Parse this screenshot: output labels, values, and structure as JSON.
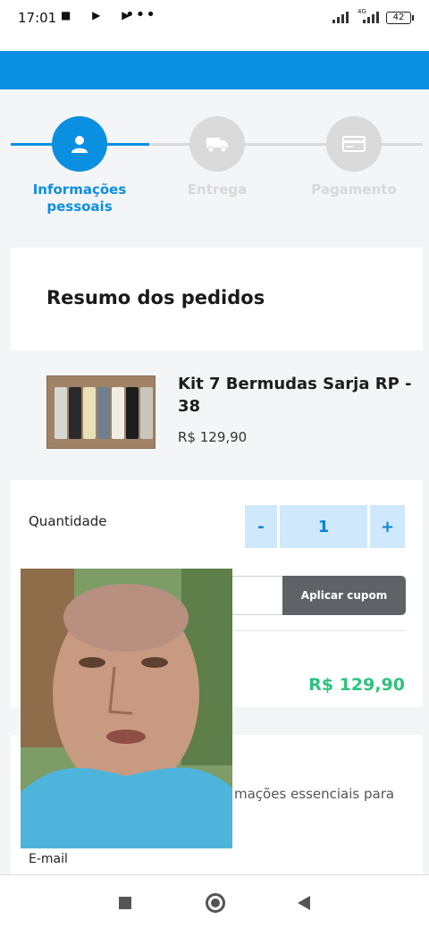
{
  "status_bar": {
    "time": "17:01",
    "icons_left": "■ ▶ ▶",
    "dots": "•••",
    "network": "4G",
    "battery": "42"
  },
  "stepper": {
    "active_color": "#0b8fe0",
    "inactive_color": "#dadada",
    "steps": [
      {
        "label_line1": "Informações",
        "label_line2": "pessoais",
        "icon": "person-icon",
        "active": true
      },
      {
        "label_line1": "Entrega",
        "label_line2": "",
        "icon": "truck-icon",
        "active": false
      },
      {
        "label_line1": "Pagamento",
        "label_line2": "",
        "icon": "credit-card-icon",
        "active": false
      }
    ]
  },
  "summary": {
    "title": "Resumo dos pedidos"
  },
  "product": {
    "name": "Kit 7 Bermudas Sarja RP - 38",
    "price": "R$ 129,90"
  },
  "quantity": {
    "label": "Quantidade",
    "minus": "-",
    "value": "1",
    "plus": "+"
  },
  "coupon": {
    "button_label": "Aplicar cupom",
    "input_value": ""
  },
  "totals": {
    "total": "R$ 129,90",
    "total_color": "#2ec27e"
  },
  "personal_info": {
    "text_partial": "mações essenciais para",
    "email_label": "E-mail"
  },
  "nav": {
    "back": "◀",
    "home": "●",
    "recents": "■"
  }
}
